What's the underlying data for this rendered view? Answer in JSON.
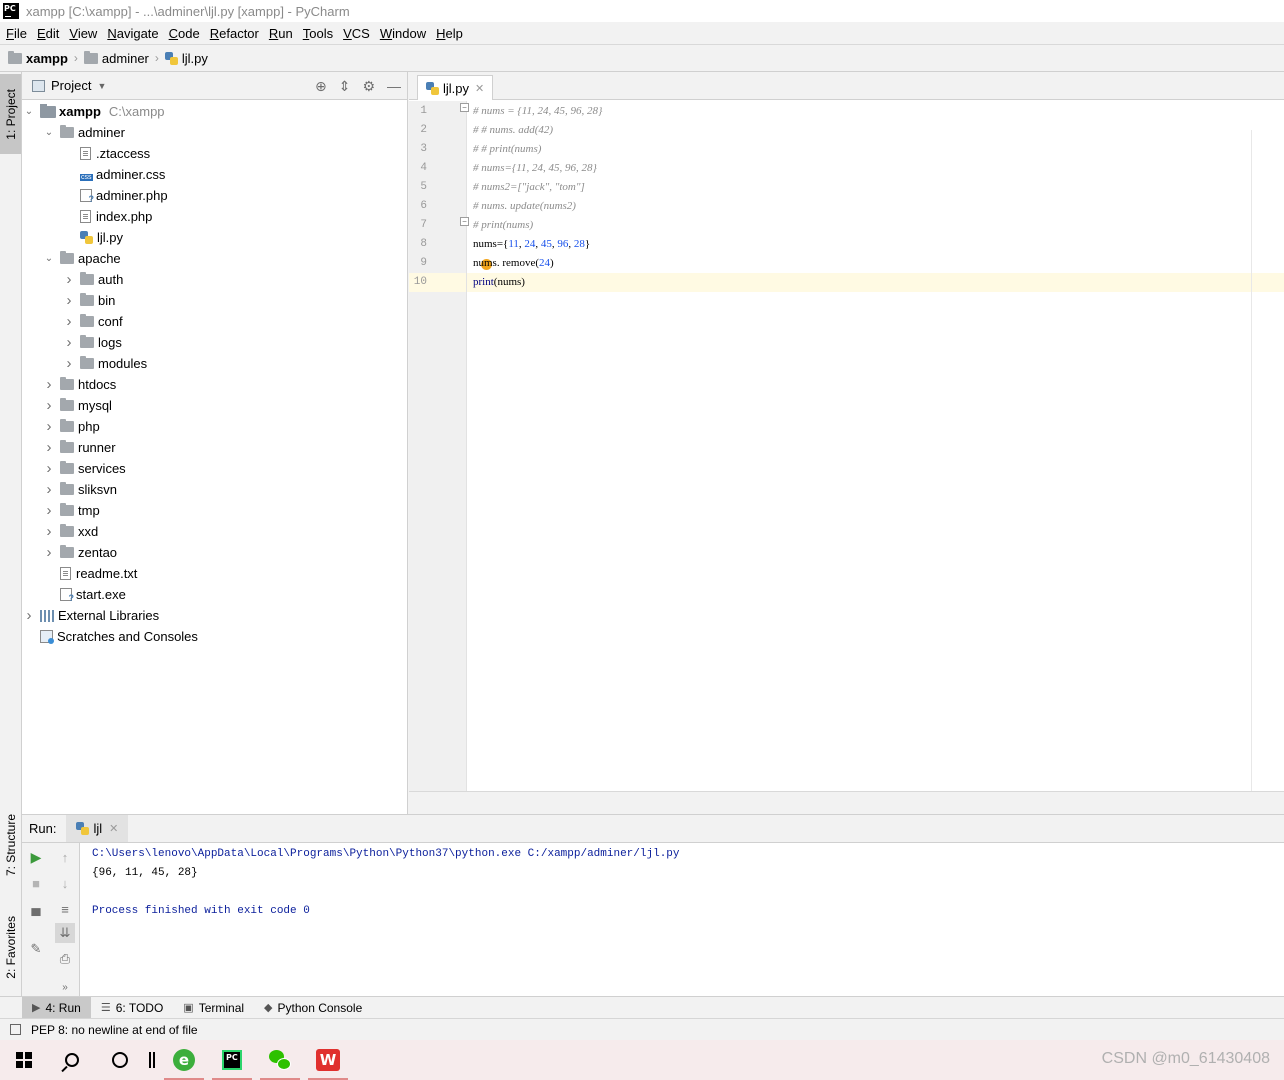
{
  "window": {
    "title": "xampp [C:\\xampp] - ...\\adminer\\ljl.py [xampp] - PyCharm",
    "app_logo": "PC"
  },
  "menu": [
    {
      "label": "File",
      "u": "F",
      "rest": "ile"
    },
    {
      "label": "Edit",
      "u": "E",
      "rest": "dit"
    },
    {
      "label": "View",
      "u": "V",
      "rest": "iew"
    },
    {
      "label": "Navigate",
      "u": "N",
      "rest": "avigate"
    },
    {
      "label": "Code",
      "u": "C",
      "rest": "ode"
    },
    {
      "label": "Refactor",
      "u": "R",
      "rest": "efactor"
    },
    {
      "label": "Run",
      "u": "R",
      "rest": "un"
    },
    {
      "label": "Tools",
      "u": "T",
      "rest": "ools"
    },
    {
      "label": "VCS",
      "u": "V",
      "rest": "CS"
    },
    {
      "label": "Window",
      "u": "W",
      "rest": "indow"
    },
    {
      "label": "Help",
      "u": "H",
      "rest": "elp"
    }
  ],
  "breadcrumb": [
    "xampp",
    "adminer",
    "ljl.py"
  ],
  "left_stripe": {
    "project": "1: Project",
    "structure": "7: Structure",
    "favorites": "2: Favorites"
  },
  "project_panel": {
    "header": "Project",
    "root_name": "xampp",
    "root_path": "C:\\xampp",
    "items": [
      {
        "label": "adminer",
        "kind": "folder",
        "expanded": true
      },
      {
        "label": ".ztaccess",
        "kind": "file"
      },
      {
        "label": "adminer.css",
        "kind": "css"
      },
      {
        "label": "adminer.php",
        "kind": "php"
      },
      {
        "label": "index.php",
        "kind": "file"
      },
      {
        "label": "ljl.py",
        "kind": "py"
      },
      {
        "label": "apache",
        "kind": "folder",
        "expanded": true
      },
      {
        "label": "auth",
        "kind": "folder"
      },
      {
        "label": "bin",
        "kind": "folder"
      },
      {
        "label": "conf",
        "kind": "folder"
      },
      {
        "label": "logs",
        "kind": "folder"
      },
      {
        "label": "modules",
        "kind": "folder"
      },
      {
        "label": "htdocs",
        "kind": "folder"
      },
      {
        "label": "mysql",
        "kind": "folder"
      },
      {
        "label": "php",
        "kind": "folder"
      },
      {
        "label": "runner",
        "kind": "folder"
      },
      {
        "label": "services",
        "kind": "folder"
      },
      {
        "label": "sliksvn",
        "kind": "folder"
      },
      {
        "label": "tmp",
        "kind": "folder"
      },
      {
        "label": "xxd",
        "kind": "folder"
      },
      {
        "label": "zentao",
        "kind": "folder"
      },
      {
        "label": "readme.txt",
        "kind": "file"
      },
      {
        "label": "start.exe",
        "kind": "php"
      },
      {
        "label": "External Libraries",
        "kind": "lib"
      },
      {
        "label": "Scratches and Consoles",
        "kind": "scratch"
      }
    ]
  },
  "editor": {
    "tab_label": "ljl.py",
    "line_numbers": [
      "1",
      "2",
      "3",
      "4",
      "5",
      "6",
      "7",
      "8",
      "9",
      "10"
    ],
    "lines": [
      "# nums = {11, 24, 45, 96, 28}",
      "# # nums. add(42)",
      "# # print(nums)",
      "# nums={11, 24, 45, 96, 28}",
      "# nums2=[\"jack\", \"tom\"]",
      "# nums. update(nums2)",
      "# print(nums)",
      "nums={11, 24, 45, 96, 28}",
      "nums. remove(24)",
      "print(nums)"
    ]
  },
  "run_panel": {
    "label": "Run:",
    "tab": "ljl",
    "console": {
      "command": "C:\\Users\\lenovo\\AppData\\Local\\Programs\\Python\\Python37\\python.exe C:/xampp/adminer/ljl.py",
      "output": "{96, 11, 45, 28}",
      "exit": "Process finished with exit code 0"
    }
  },
  "bottom_tools": [
    {
      "label": "4: Run",
      "icon": "run-icon",
      "active": true
    },
    {
      "label": "6: TODO",
      "icon": "todo-icon",
      "active": false
    },
    {
      "label": "Terminal",
      "icon": "terminal-icon",
      "active": false
    },
    {
      "label": "Python Console",
      "icon": "python-console-icon",
      "active": false
    }
  ],
  "status": {
    "message": "PEP 8: no newline at end of file"
  },
  "taskbar": {
    "edge_glyph": "e",
    "pycharm_glyph": "PC",
    "wps_glyph": "W",
    "watermark": "CSDN @m0_61430408"
  }
}
